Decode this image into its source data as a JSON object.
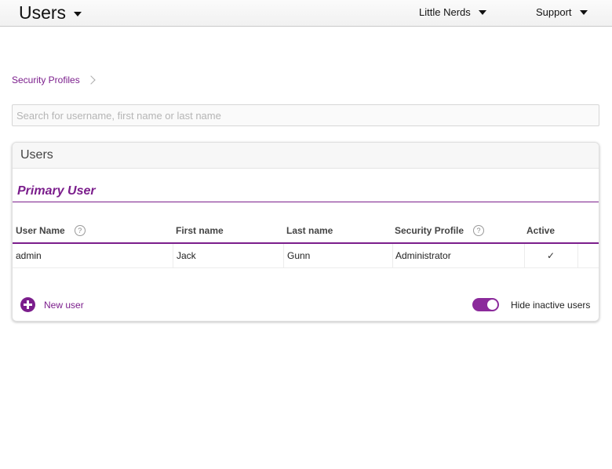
{
  "header": {
    "app_title": "Users",
    "org_menu": "Little Nerds",
    "support_menu": "Support"
  },
  "breadcrumb": {
    "link": "Security Profiles"
  },
  "search": {
    "placeholder": "Search for username, first name or last name",
    "value": ""
  },
  "card": {
    "title": "Users",
    "section_title": "Primary User",
    "columns": [
      "User Name",
      "First name",
      "Last name",
      "Security Profile",
      "Active"
    ],
    "rows": [
      {
        "username": "admin",
        "first_name": "Jack",
        "last_name": "Gunn",
        "profile": "Administrator",
        "active": "✓"
      }
    ],
    "new_user_label": "New user",
    "hide_inactive_label": "Hide inactive users",
    "hide_inactive_on": true
  },
  "icons": {
    "header_caret": "chevron-down-icon",
    "breadcrumb_chevron": "chevron-right-icon",
    "help": "help-icon",
    "add": "plus-circle-icon"
  },
  "colors": {
    "accent": "#7b1e8c",
    "toggle": "#8b2a9b"
  }
}
